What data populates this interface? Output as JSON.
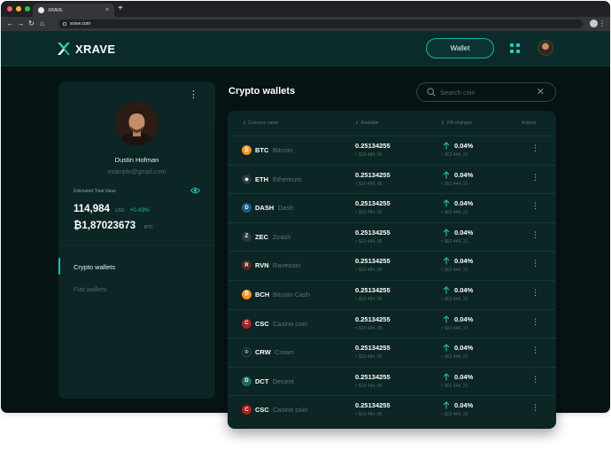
{
  "browser": {
    "tab_title": "XRAVE",
    "tab_close": "×",
    "new_tab": "+",
    "url": "xrave.com"
  },
  "header": {
    "logo_text": "XRAVE",
    "wallet_button": "Wallet"
  },
  "profile": {
    "name": "Dustin Hofman",
    "email": "example@gmail.com",
    "estimated_label": "Estimated Total Value",
    "balance": "114,984",
    "balance_unit": "USD",
    "balance_change": "+0.43%",
    "btc_balance": "₿1,87023673",
    "btc_unit": "BTC",
    "nav": {
      "crypto": "Crypto wallets",
      "fiat": "Fiat wallets"
    }
  },
  "wallets": {
    "title": "Crypto wallets",
    "search_placeholder": "Search coin",
    "columns": {
      "currency": "Currency name",
      "available": "Available",
      "changes": "24h changes",
      "actions": "Actions"
    },
    "rows": [
      {
        "symbol": "BTC",
        "name": "Bitcoin",
        "available": "0.25134255",
        "available_usd": "≈ $10 484, 85",
        "change": "0.04%",
        "change_usd": "≈ $62 444, 21",
        "color": "#f7931a",
        "icon": "₿"
      },
      {
        "symbol": "ETH",
        "name": "Ethereum",
        "available": "0.25134255",
        "available_usd": "≈ $10 484, 85",
        "change": "0.04%",
        "change_usd": "≈ $62 444, 21",
        "color": "#2a3a3a",
        "icon": "◆"
      },
      {
        "symbol": "DASH",
        "name": "Dash",
        "available": "0.25134255",
        "available_usd": "≈ $10 484, 85",
        "change": "0.04%",
        "change_usd": "≈ $62 444, 21",
        "color": "#1c5a86",
        "icon": "D"
      },
      {
        "symbol": "ZEC",
        "name": "Zcash",
        "available": "0.25134255",
        "available_usd": "≈ $10 484, 85",
        "change": "0.04%",
        "change_usd": "≈ $62 444, 21",
        "color": "#2a3a3a",
        "icon": "Z"
      },
      {
        "symbol": "RVN",
        "name": "Ravecoin",
        "available": "0.25134255",
        "available_usd": "≈ $10 484, 85",
        "change": "0.04%",
        "change_usd": "≈ $62 444, 21",
        "color": "#5a2626",
        "icon": "R"
      },
      {
        "symbol": "BCH",
        "name": "Bitcoin Cash",
        "available": "0.25134255",
        "available_usd": "≈ $10 484, 85",
        "change": "0.04%",
        "change_usd": "≈ $62 444, 21",
        "color": "#f7931a",
        "icon": "₿"
      },
      {
        "symbol": "CSC",
        "name": "Casino coin",
        "available": "0.25134255",
        "available_usd": "≈ $10 484, 85",
        "change": "0.04%",
        "change_usd": "≈ $62 444, 21",
        "color": "#b31d1d",
        "icon": "C"
      },
      {
        "symbol": "CRW",
        "name": "Crown",
        "available": "0.25134255",
        "available_usd": "≈ $10 484, 85",
        "change": "0.04%",
        "change_usd": "≈ $62 444, 21",
        "color": "#0c2525",
        "icon": "♔"
      },
      {
        "symbol": "DCT",
        "name": "Decent",
        "available": "0.25134255",
        "available_usd": "≈ $10 484, 85",
        "change": "0.04%",
        "change_usd": "≈ $62 444, 21",
        "color": "#1f6b57",
        "icon": "D"
      },
      {
        "symbol": "CSC",
        "name": "Casino coin",
        "available": "0.25134255",
        "available_usd": "≈ $10 484, 85",
        "change": "0.04%",
        "change_usd": "≈ $62 444, 21",
        "color": "#b31d1d",
        "icon": "C"
      }
    ]
  },
  "colors": {
    "accent": "#19c3b3",
    "positive": "#19c38c",
    "background": "#061414",
    "card": "#0c2525"
  }
}
